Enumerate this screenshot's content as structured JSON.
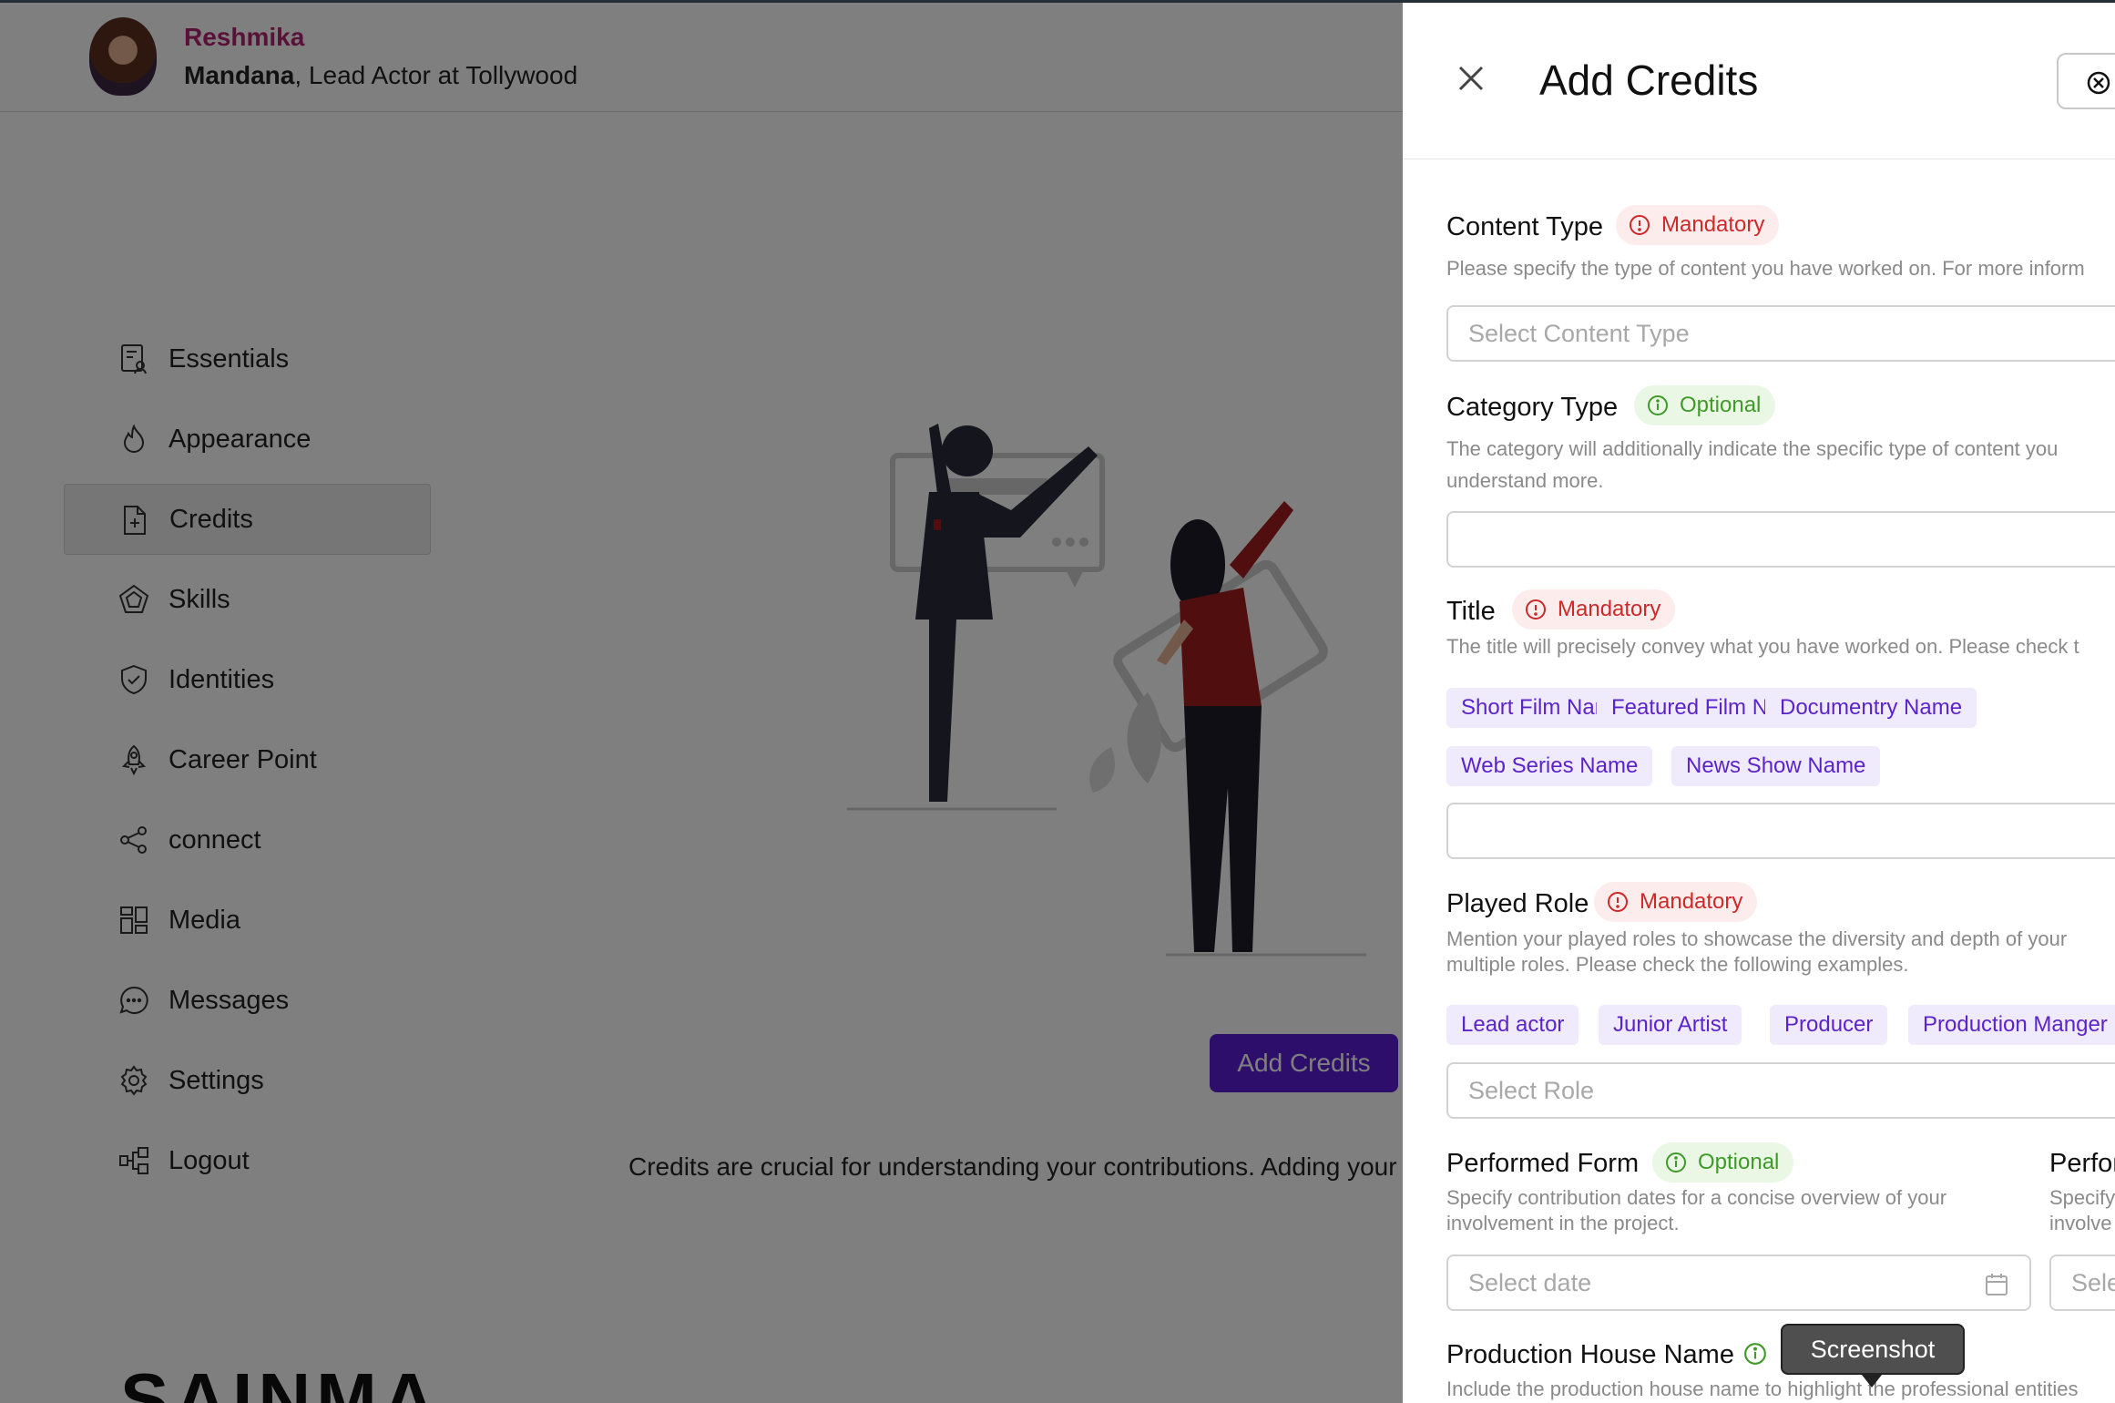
{
  "user": {
    "display_name": "Reshmika",
    "name": "Mandana",
    "title_suffix": ", Lead Actor at Tollywood"
  },
  "sidebar": {
    "items": [
      {
        "label": "Essentials",
        "icon": "document-person-icon",
        "active": false
      },
      {
        "label": "Appearance",
        "icon": "flame-icon",
        "active": false
      },
      {
        "label": "Credits",
        "icon": "document-plus-icon",
        "active": true
      },
      {
        "label": "Skills",
        "icon": "pentagon-badge-icon",
        "active": false
      },
      {
        "label": "Identities",
        "icon": "shield-check-icon",
        "active": false
      },
      {
        "label": "Career Point",
        "icon": "rocket-icon",
        "active": false
      },
      {
        "label": "connect",
        "icon": "share-icon",
        "active": false
      },
      {
        "label": "Media",
        "icon": "grid-icon",
        "active": false
      },
      {
        "label": "Messages",
        "icon": "chat-icon",
        "active": false
      },
      {
        "label": "Settings",
        "icon": "gear-icon",
        "active": false
      },
      {
        "label": "Logout",
        "icon": "logout-icon",
        "active": false
      }
    ]
  },
  "main": {
    "cta_label": "Add Credits",
    "description": "Credits are crucial for understanding your contributions. Adding your c",
    "brand": "SAINMA"
  },
  "drawer": {
    "title": "Add Credits",
    "fields": {
      "content_type": {
        "label": "Content Type",
        "badge": "Mandatory",
        "help": "Please specify the type of content you have worked on. For more inform",
        "placeholder": "Select Content Type"
      },
      "category_type": {
        "label": "Category Type",
        "badge": "Optional",
        "help_line1": "The category will additionally indicate the specific type of content you",
        "help_line2": "understand more.",
        "value": ""
      },
      "title": {
        "label": "Title",
        "badge": "Mandatory",
        "help": "The title will precisely convey what you have worked on. Please check t",
        "chips": [
          "Short Film Name",
          "Featured Film Name",
          "Documentry Name",
          "Web Series Name",
          "News Show Name"
        ],
        "value": ""
      },
      "played_role": {
        "label": "Played Role",
        "badge": "Mandatory",
        "help_line1": "Mention your played roles to showcase the diversity and depth of your",
        "help_line2": "multiple roles. Please check the following examples.",
        "chips": [
          "Lead actor",
          "Junior Artist",
          "Producer",
          "Production Manger"
        ],
        "placeholder": "Select Role"
      },
      "performed_form": {
        "label": "Performed Form",
        "badge": "Optional",
        "help_line1": "Specify contribution dates for a concise overview of your",
        "help_line2": "involvement in the project.",
        "placeholder": "Select date"
      },
      "performed_to": {
        "label": "Perfor",
        "help_line1": "Specify",
        "help_line2": "involve",
        "placeholder": "Sele"
      },
      "production_house": {
        "label": "Production House Name",
        "help": "Include the production house name to highlight the professional entities"
      }
    }
  },
  "tooltip": {
    "text": "Screenshot"
  },
  "colors": {
    "accent": "#5a1fd6",
    "chip_bg": "#f0eafd",
    "mandatory": "#cc2a2a",
    "optional": "#3f9a2a",
    "user_name": "#b02470"
  }
}
